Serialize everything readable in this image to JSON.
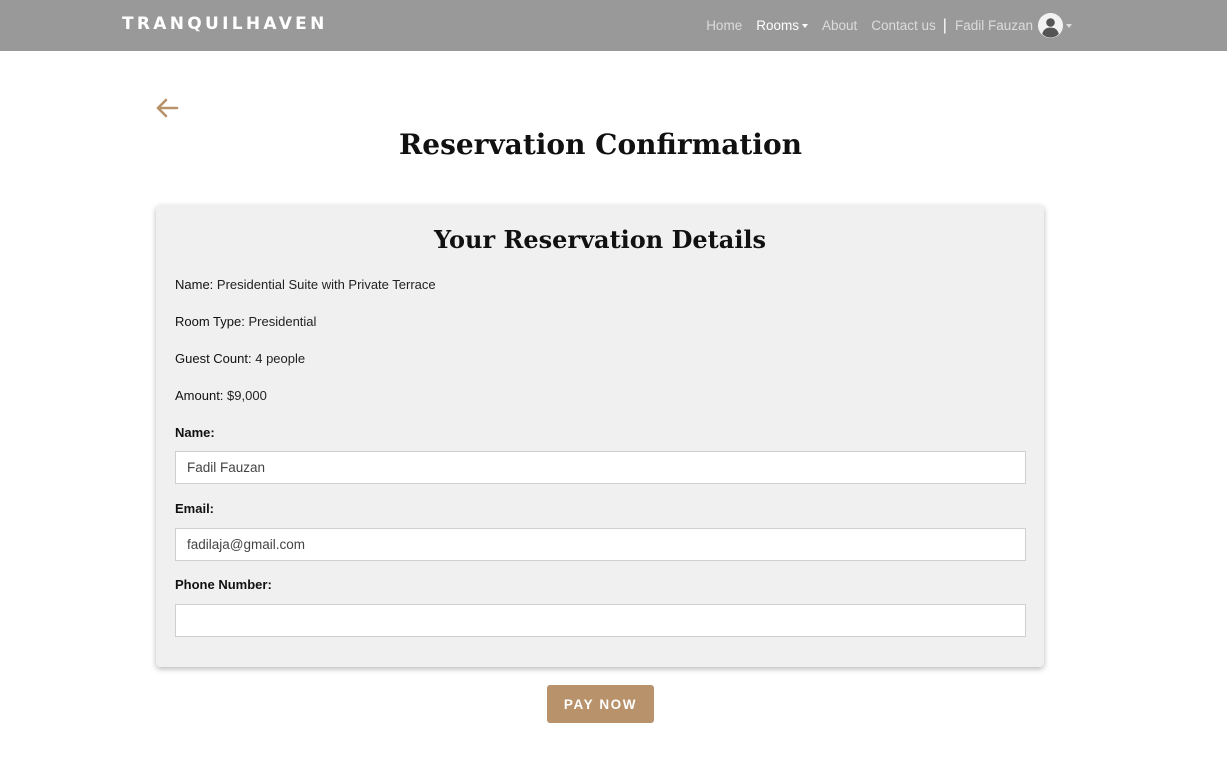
{
  "nav": {
    "brand": "TRANQUILHAVEN",
    "links": [
      "Home",
      "Rooms",
      "About",
      "Contact us"
    ],
    "separator": "|",
    "user_name": "Fadil Fauzan"
  },
  "page": {
    "title": "Reservation Confirmation"
  },
  "card": {
    "title": "Your Reservation Details",
    "details": [
      {
        "key": "Name:",
        "value": "Presidential Suite with Private Terrace"
      },
      {
        "key": "Room Type:",
        "value": "Presidential"
      },
      {
        "key": "Guest Count:",
        "value": "4 people"
      },
      {
        "key": "Amount:",
        "value": "$9,000"
      }
    ],
    "form": {
      "name_label": "Name:",
      "name_value": "Fadil Fauzan",
      "email_label": "Email:",
      "email_value": "fadilaja@gmail.com",
      "phone_label": "Phone Number:",
      "phone_value": ""
    }
  },
  "actions": {
    "pay_label": "PAY NOW"
  },
  "colors": {
    "navbar": "#999999",
    "accent": "#b8926a",
    "card_bg": "#f0f0f0"
  },
  "icons": {
    "back": "arrow-left-icon",
    "avatar": "user-avatar-icon",
    "dropdown": "caret-down-icon"
  }
}
